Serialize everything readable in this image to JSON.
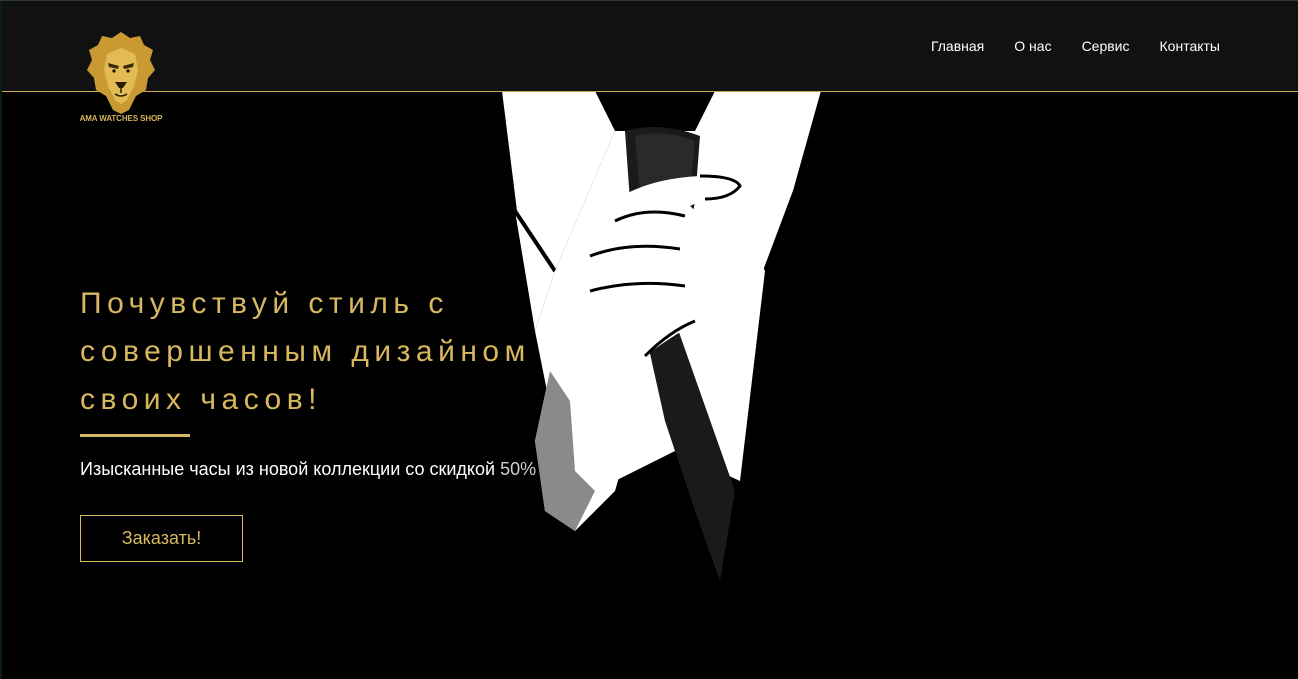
{
  "brand": {
    "logo_text": "AMA WATCHES SHOP",
    "accent_color": "#d8b85e"
  },
  "nav": {
    "items": [
      {
        "label": "Главная"
      },
      {
        "label": "О нас"
      },
      {
        "label": "Сервис"
      },
      {
        "label": "Контакты"
      }
    ]
  },
  "hero": {
    "headline_lines": [
      "Почувствуй стиль с",
      "совершенным дизайном",
      "своих часов!"
    ],
    "subtitle": "Изысканные часы из новой коллекции со скидкой",
    "discount": "50%",
    "cta_label": "Заказать!",
    "illustration": "suit-tie-hand-illustration"
  }
}
